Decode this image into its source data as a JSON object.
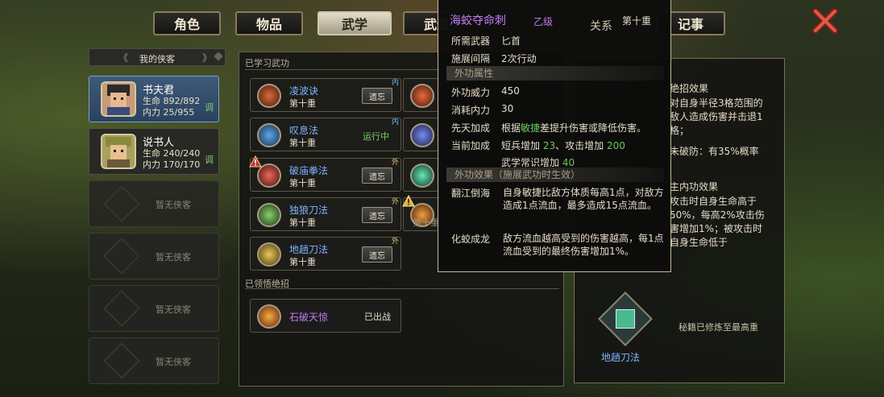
{
  "tabs": [
    {
      "label": "角色"
    },
    {
      "label": "物品"
    },
    {
      "label": "武学"
    },
    {
      "label": "武道"
    },
    {
      "label": "记事"
    }
  ],
  "sidebar": {
    "title": "我的侠客",
    "heroes": [
      {
        "name": "书夫君",
        "hp": "生命 892/892",
        "mp": "内力 25/955",
        "tune": "调"
      },
      {
        "name": "说书人",
        "hp": "生命 240/240",
        "mp": "内力 170/170",
        "tune": "调"
      }
    ],
    "empty_label": "暂无侠客"
  },
  "learned": {
    "title": "已学习武功",
    "left_skills": [
      {
        "name": "凌波诀",
        "level": "第十重",
        "action": "遗忘",
        "flag": "内"
      },
      {
        "name": "叹息法",
        "level": "第十重",
        "status": "运行中",
        "flag": "内"
      },
      {
        "name": "破庙拳法",
        "level": "第十重",
        "action": "遗忘",
        "flag": "外"
      },
      {
        "name": "独狼刀法",
        "level": "第十重",
        "action": "遗忘",
        "flag": "外"
      },
      {
        "name": "地趟刀法",
        "level": "第十重",
        "action": "遗忘",
        "flag": "外"
      }
    ],
    "partial_text": "第十重"
  },
  "ultimate": {
    "title": "已领悟绝招",
    "skill": {
      "name": "石破天惊",
      "status": "已出战"
    }
  },
  "tooltip": {
    "title": "海蛟夺命刺",
    "grade": "乙级",
    "rank": "第十重",
    "weapon_label": "所需武器",
    "weapon_value": "匕首",
    "interval_label": "施展间隔",
    "interval_value": "2次行动",
    "outer_attr": "外功属性",
    "power_label": "外功威力",
    "power_value": "450",
    "cost_label": "消耗内力",
    "cost_value": "30",
    "bonus_label": "先天加成",
    "bonus_pre": "根据",
    "bonus_key": "敏捷",
    "bonus_post": "差提升伤害或降低伤害。",
    "current_label": "当前加成",
    "cur1_pre": "短兵增加 ",
    "cur1_v": "23",
    "cur1_mid": "、攻击增加 ",
    "cur1_v2": "200",
    "cur2_pre": "武学常识增加 ",
    "cur2_v": "40",
    "effect_hdr": "外功效果（施展武功时生效）",
    "eff1_label": "翻江倒海",
    "eff1_desc": "自身敏捷比敌方体质每高1点，对敌方造成1点流血，最多造成15点流血。",
    "eff2_label": "化蛟成龙",
    "eff2_desc": "敌方流血越高受到的伤害越高，每1点流血受到的最终伤害增加1%。"
  },
  "right": {
    "tab_relation": "关系",
    "ult_effect_title": "绝招效果",
    "ult_effect_desc": "对自身半径3格范围的敌人造成伤害并击退1格；",
    "ult_partial": "未破防：有35%概率",
    "inner_effect_title": "主内功效果",
    "inner_effect_desc": "攻击时自身生命高于50%，每高2%攻击伤害增加1%；被攻击时自身生命低于",
    "book_name": "地趟刀法",
    "book_status": "秘籍已修炼至最高重"
  },
  "colors": {
    "accent": "#c07cf0",
    "green": "#6cc85a",
    "blue_name": "#7fb4ff",
    "close": "#d84a40"
  }
}
